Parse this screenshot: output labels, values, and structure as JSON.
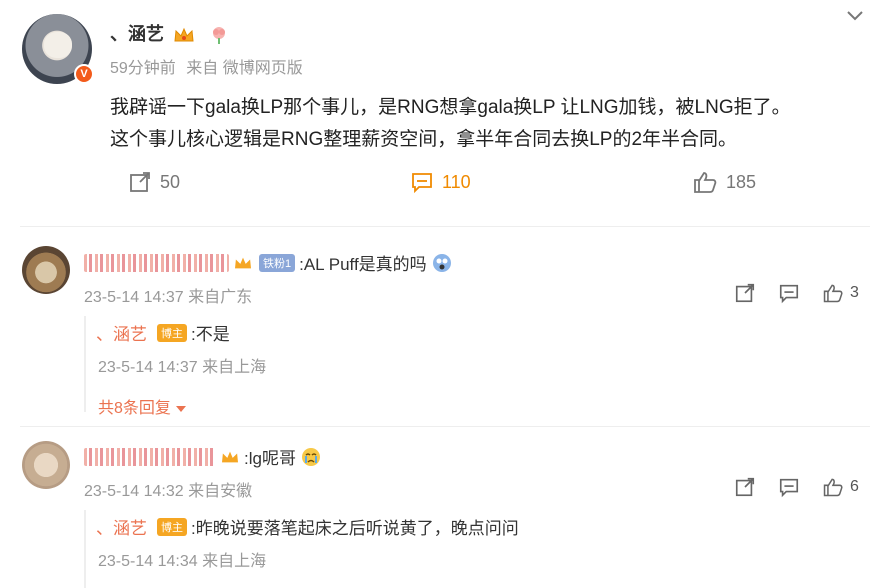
{
  "post": {
    "author": "、涵艺",
    "time": "59分钟前",
    "source": "来自 微博网页版",
    "verified_badge": "V",
    "text_line1": "我辟谣一下gala换LP那个事儿，是RNG想拿gala换LP 让LNG加钱，被LNG拒了。",
    "text_line2": "这个事儿核心逻辑是RNG整理薪资空间，拿半年合同去换LP的2年半合同。",
    "repost_count": "50",
    "comment_count": "110",
    "like_count": "185",
    "active_color": "#f08a00"
  },
  "comments": [
    {
      "text": ":AL Puff是真的吗",
      "fan_badge": "铁粉1",
      "time": "23-5-14 14:37 来自广东",
      "likes": "3",
      "reply": {
        "name": "、涵艺",
        "badge": "博主",
        "text": ":不是",
        "time": "23-5-14 14:37 来自上海"
      },
      "more_replies": "共8条回复"
    },
    {
      "text": ":lg呢哥",
      "time": "23-5-14 14:32 来自安徽",
      "likes": "6",
      "reply": {
        "name": "、涵艺",
        "badge": "博主",
        "text": ":昨晚说要落笔起床之后听说黄了，晚点问问",
        "time": "23-5-14 14:34 来自上海"
      }
    }
  ],
  "icons": [
    "chevron-down-icon",
    "repost-icon",
    "comment-icon",
    "like-icon",
    "crown-icon",
    "emoji-icon",
    "caret-down-icon"
  ]
}
